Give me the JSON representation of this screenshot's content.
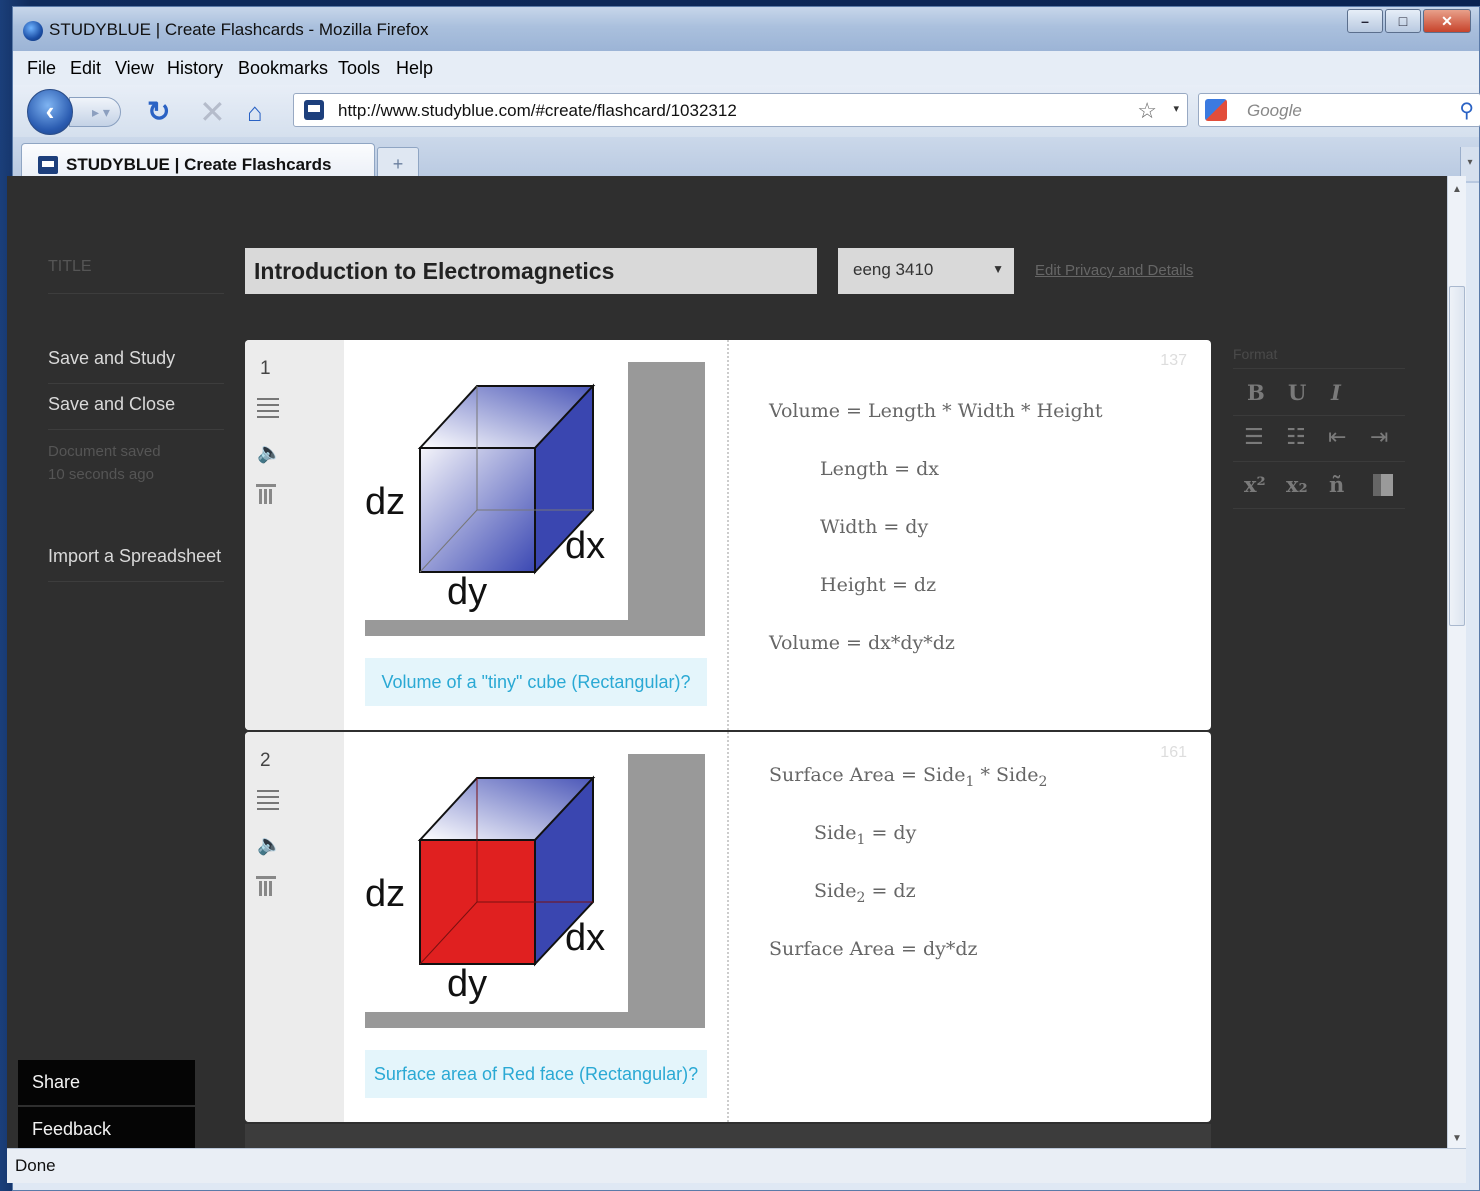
{
  "window": {
    "title": "STUDYBLUE | Create Flashcards - Mozilla Firefox"
  },
  "menu": [
    "File",
    "Edit",
    "View",
    "History",
    "Bookmarks",
    "Tools",
    "Help"
  ],
  "nav": {
    "url": "http://www.studyblue.com/#create/flashcard/1032312",
    "search_placeholder": "Google"
  },
  "tab": {
    "label": "STUDYBLUE | Create Flashcards"
  },
  "status": "Done",
  "page": {
    "title_label": "TITLE",
    "title_value": "Introduction to Electromagnetics",
    "course": "eeng 3410",
    "privacy_link": "Edit Privacy and Details",
    "save_study": "Save and Study",
    "save_close": "Save and Close",
    "saved_line1": "Document saved",
    "saved_line2": "10 seconds ago",
    "import": "Import a Spreadsheet",
    "share": "Share",
    "feedback": "Feedback"
  },
  "cards": [
    {
      "number": "1",
      "count": "137",
      "image_labels": {
        "dz": "dz",
        "dx": "dx",
        "dy": "dy"
      },
      "front_color": "blue",
      "question": "Volume of a \"tiny\" cube (Rectangular)?",
      "answer": {
        "l1": "Volume = Length * Width * Height",
        "l2": "Length = dx",
        "l3": "Width = dy",
        "l4": "Height = dz",
        "l5": "Volume = dx*dy*dz"
      }
    },
    {
      "number": "2",
      "count": "161",
      "image_labels": {
        "dz": "dz",
        "dx": "dx",
        "dy": "dy"
      },
      "front_color": "red",
      "question": "Surface area of Red face (Rectangular)?",
      "answer": {
        "l1a": "Surface Area = Side",
        "l1b": "1",
        "l1c": " * Side",
        "l1d": "2",
        "l2a": "Side",
        "l2b": "1",
        "l2c": " = dy",
        "l3a": "Side",
        "l3b": "2",
        "l3c": " = dz",
        "l4": "Surface Area = dy*dz"
      }
    }
  ],
  "format": {
    "label": "Format",
    "bold": "B",
    "underline": "U",
    "italic": "I",
    "superscript": "x²",
    "subscript": "x₂",
    "special": "ñ"
  },
  "icons": [
    "firefox-icon",
    "back-icon",
    "forward-icon",
    "reload-icon",
    "stop-icon",
    "home-icon",
    "site-icon",
    "bookmark-star-icon",
    "google-icon",
    "search-icon",
    "reorder-icon",
    "speaker-icon",
    "trash-icon",
    "bullet-list-icon",
    "numbered-list-icon",
    "outdent-icon",
    "indent-icon",
    "color-icon"
  ]
}
